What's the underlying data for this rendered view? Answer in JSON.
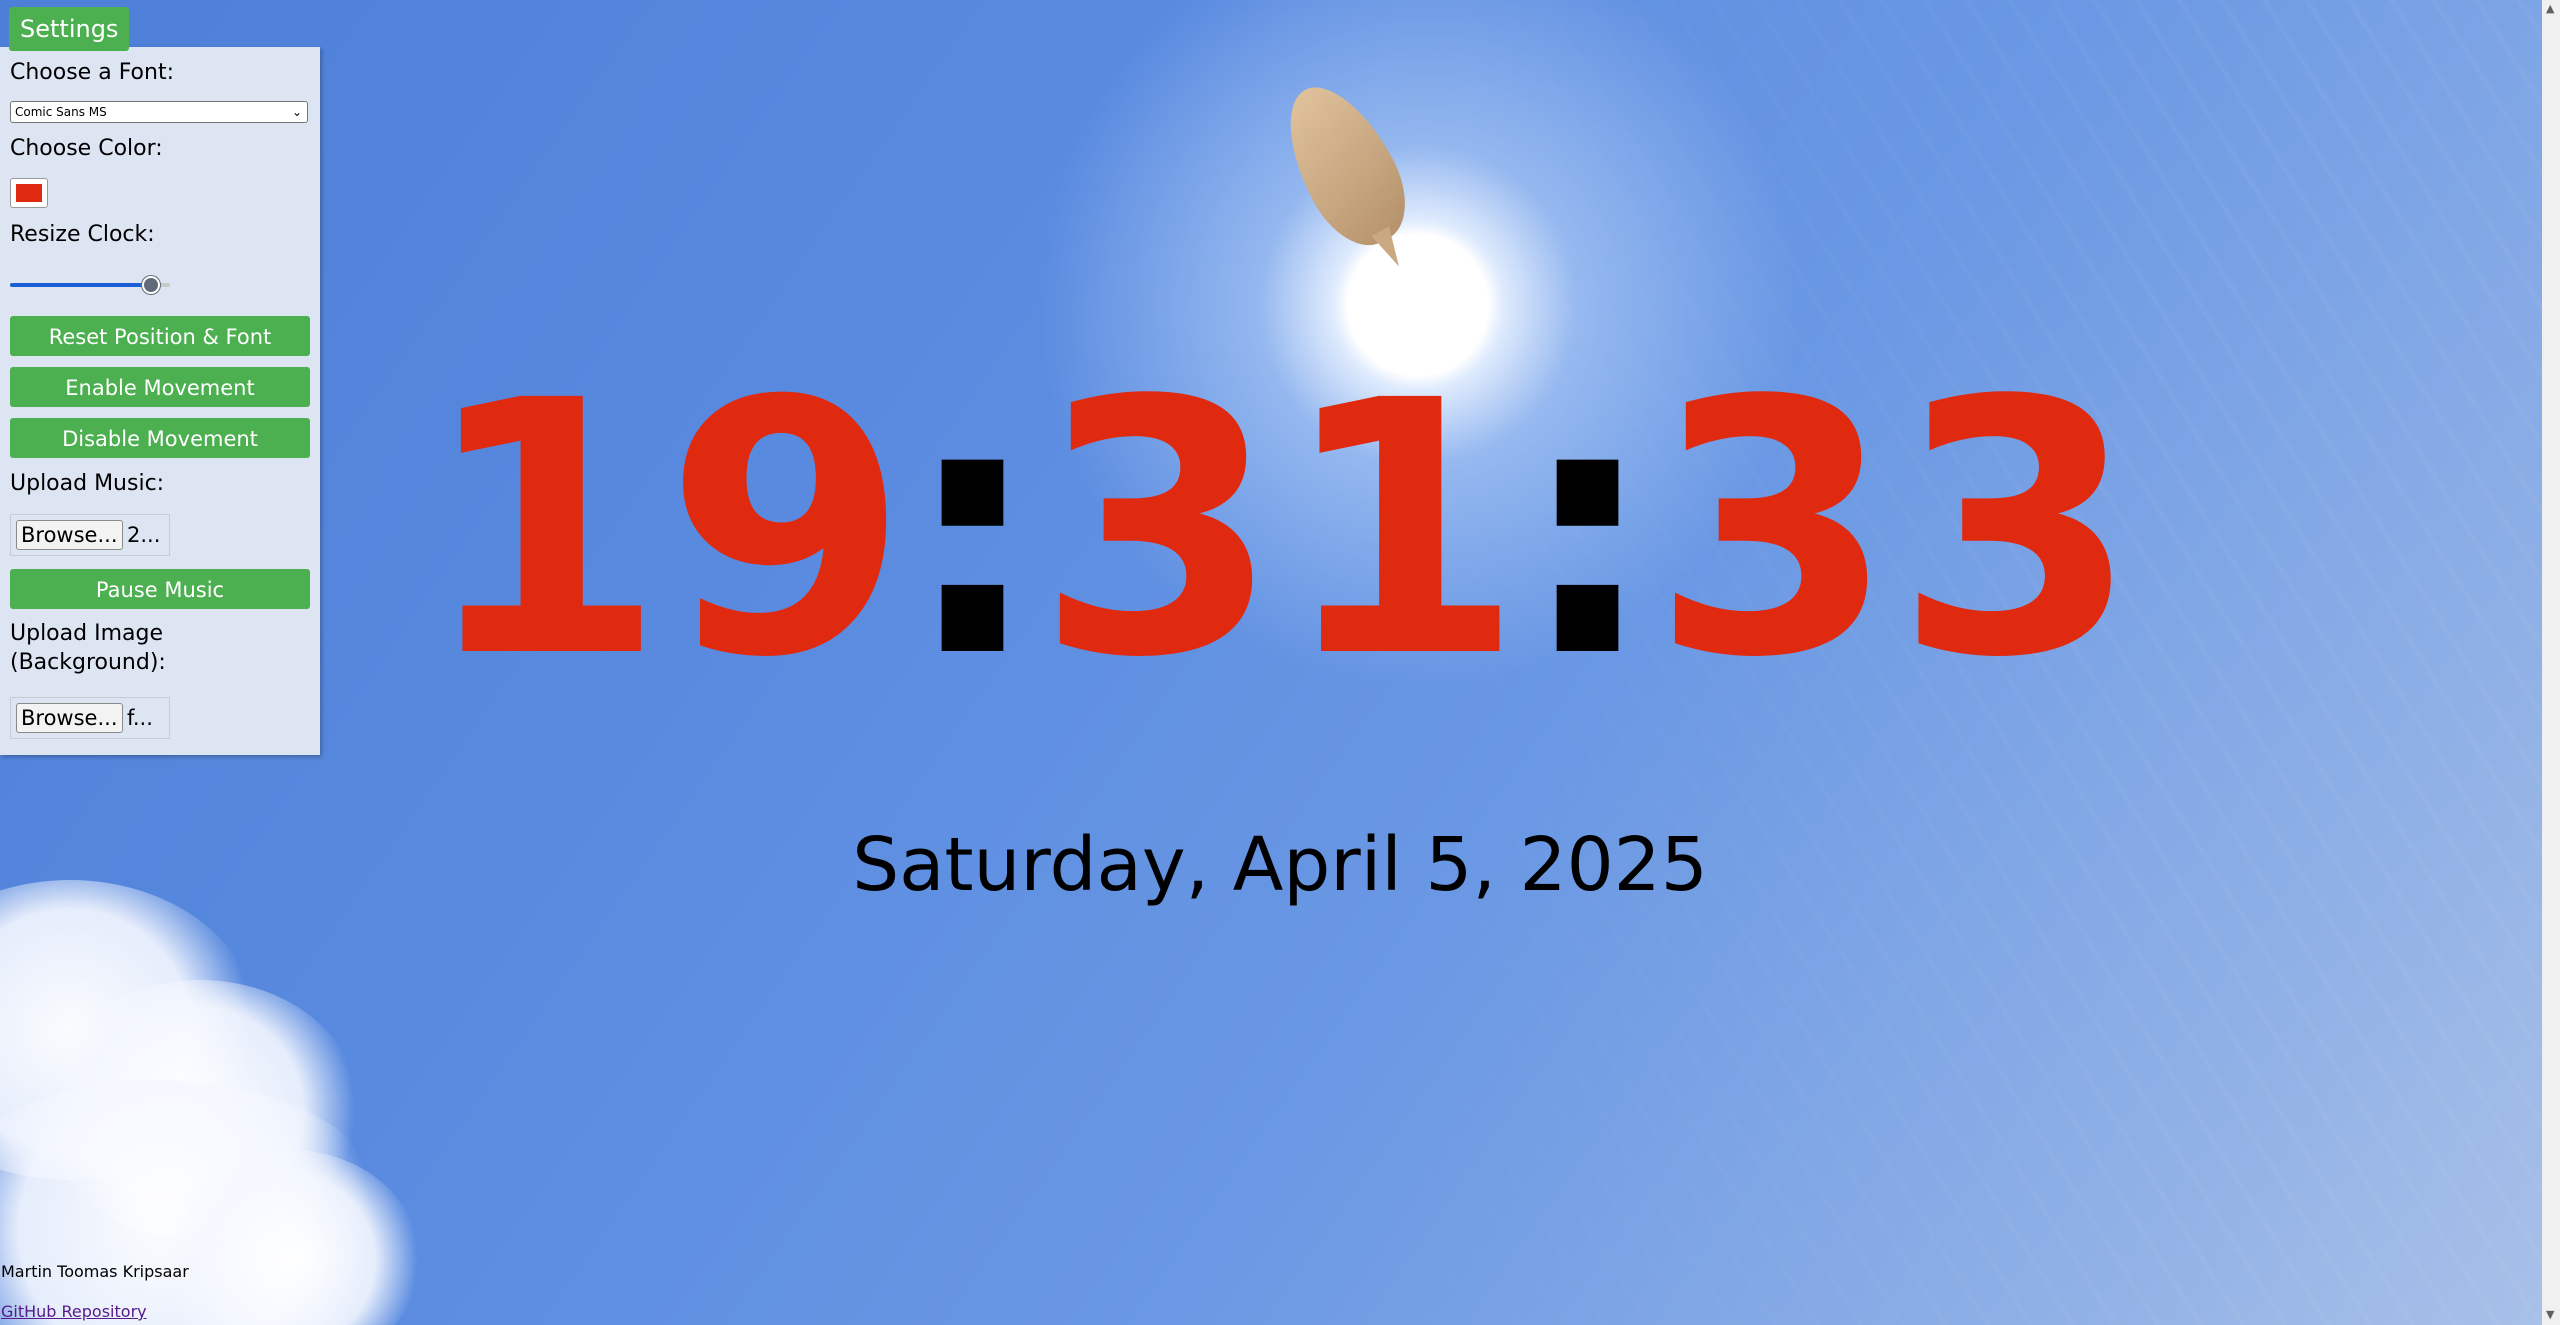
{
  "settings": {
    "toggle_label": "Settings",
    "font_label": "Choose a Font:",
    "font_selected": "Comic Sans MS",
    "color_label": "Choose Color:",
    "color_value": "#e02a10",
    "resize_label": "Resize Clock:",
    "resize_fraction": 0.93,
    "reset_label": "Reset Position & Font",
    "enable_label": "Enable Movement",
    "disable_label": "Disable Movement",
    "music_label": "Upload Music:",
    "music_browse": "Browse...",
    "music_file": "2...",
    "pause_label": "Pause Music",
    "image_label_line1": "Upload Image",
    "image_label_line2": "(Background):",
    "image_browse": "Browse...",
    "image_file": "f..."
  },
  "clock": {
    "hours": "19",
    "minutes": "31",
    "seconds": "33",
    "separator": ":",
    "digit_color": "#e02a10",
    "separator_color": "#000000"
  },
  "date": "Saturday, April 5, 2025",
  "footer": {
    "author": "Martin Toomas Kripsaar",
    "repo_link": "GitHub Repository"
  }
}
